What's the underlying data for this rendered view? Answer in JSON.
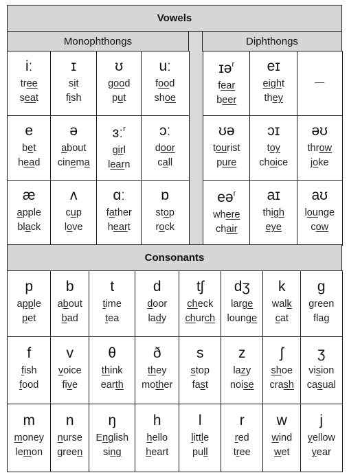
{
  "vowels": {
    "title": "Vowels",
    "monophthongs": {
      "title": "Monophthongs",
      "rows": [
        [
          {
            "symbol": "iː",
            "words": [
              [
                "tr",
                "ee"
              ],
              [
                "s",
                "ea",
                "t"
              ]
            ]
          },
          {
            "symbol": "ɪ",
            "words": [
              [
                "s",
                "i",
                "t"
              ],
              [
                "f",
                "i",
                "sh"
              ]
            ]
          },
          {
            "symbol": "ʊ",
            "words": [
              [
                "g",
                "oo",
                "d"
              ],
              [
                "p",
                "u",
                "t"
              ]
            ]
          },
          {
            "symbol": "uː",
            "words": [
              [
                "f",
                "oo",
                "d"
              ],
              [
                "sh",
                "oe"
              ]
            ]
          }
        ],
        [
          {
            "symbol": "e",
            "words": [
              [
                "b",
                "e",
                "t"
              ],
              [
                "h",
                "ea",
                "d"
              ]
            ]
          },
          {
            "symbol": "ə",
            "words": [
              [
                "",
                "a",
                "bout"
              ],
              [
                "cin",
                "e",
                "m",
                "a"
              ]
            ]
          },
          {
            "symbol": "ɜː",
            "sup": "r",
            "words": [
              [
                "g",
                "ir",
                "l"
              ],
              [
                "l",
                "ear",
                "n"
              ]
            ]
          },
          {
            "symbol": "ɔː",
            "words": [
              [
                "d",
                "oor"
              ],
              [
                "c",
                "a",
                "ll"
              ]
            ]
          }
        ],
        [
          {
            "symbol": "æ",
            "words": [
              [
                "",
                "a",
                "pple"
              ],
              [
                "bl",
                "a",
                "ck"
              ]
            ]
          },
          {
            "symbol": "ʌ",
            "words": [
              [
                "c",
                "u",
                "p"
              ],
              [
                "l",
                "o",
                "ve"
              ]
            ]
          },
          {
            "symbol": "ɑː",
            "words": [
              [
                "f",
                "a",
                "ther"
              ],
              [
                "h",
                "ear",
                "t"
              ]
            ]
          },
          {
            "symbol": "ɒ",
            "words": [
              [
                "st",
                "o",
                "p"
              ],
              [
                "r",
                "o",
                "ck"
              ]
            ]
          }
        ]
      ]
    },
    "diphthongs": {
      "title": "Diphthongs",
      "rows": [
        [
          {
            "symbol": "ɪə",
            "sup": "r",
            "words": [
              [
                "f",
                "ear"
              ],
              [
                "b",
                "eer"
              ]
            ]
          },
          {
            "symbol": "eɪ",
            "words": [
              [
                "",
                "eigh",
                "t"
              ],
              [
                "th",
                "ey"
              ]
            ]
          },
          {
            "symbol": "",
            "dash": "—",
            "words": []
          }
        ],
        [
          {
            "symbol": "ʊə",
            "words": [
              [
                "t",
                "ou",
                "rist"
              ],
              [
                "p",
                "ure"
              ]
            ]
          },
          {
            "symbol": "ɔɪ",
            "words": [
              [
                "t",
                "oy"
              ],
              [
                "ch",
                "oi",
                "ce"
              ]
            ]
          },
          {
            "symbol": "əʊ",
            "words": [
              [
                "thr",
                "ow"
              ],
              [
                "j",
                "o",
                "ke"
              ]
            ]
          }
        ],
        [
          {
            "symbol": "eə",
            "sup": "r",
            "words": [
              [
                "wh",
                "ere"
              ],
              [
                "ch",
                "air"
              ]
            ]
          },
          {
            "symbol": "aɪ",
            "words": [
              [
                "th",
                "igh"
              ],
              [
                "",
                "eye"
              ]
            ]
          },
          {
            "symbol": "aʊ",
            "words": [
              [
                "l",
                "ou",
                "nge"
              ],
              [
                "c",
                "ow"
              ]
            ]
          }
        ]
      ]
    }
  },
  "consonants": {
    "title": "Consonants",
    "rows": [
      [
        {
          "symbol": "p",
          "words": [
            [
              "a",
              "pp",
              "le"
            ],
            [
              "",
              "p",
              "et"
            ]
          ]
        },
        {
          "symbol": "b",
          "words": [
            [
              "a",
              "b",
              "out"
            ],
            [
              "",
              "b",
              "ad"
            ]
          ]
        },
        {
          "symbol": "t",
          "words": [
            [
              "",
              "t",
              "ime"
            ],
            [
              "",
              "t",
              "ea"
            ]
          ]
        },
        {
          "symbol": "d",
          "words": [
            [
              "",
              "d",
              "oor"
            ],
            [
              "la",
              "d",
              "y"
            ]
          ]
        },
        {
          "symbol": "tʃ",
          "words": [
            [
              "",
              "ch",
              "eck"
            ],
            [
              "",
              "ch",
              "ur",
              "ch"
            ]
          ]
        },
        {
          "symbol": "dʒ",
          "words": [
            [
              "lar",
              "ge"
            ],
            [
              "loun",
              "ge"
            ]
          ]
        },
        {
          "symbol": "k",
          "words": [
            [
              "wal",
              "k"
            ],
            [
              "",
              "c",
              "at"
            ]
          ]
        },
        {
          "symbol": "g",
          "words": [
            [
              "green"
            ],
            [
              "flag"
            ]
          ]
        }
      ],
      [
        {
          "symbol": "f",
          "words": [
            [
              "",
              "f",
              "ish"
            ],
            [
              "",
              "f",
              "ood"
            ]
          ]
        },
        {
          "symbol": "v",
          "words": [
            [
              "",
              "v",
              "oice"
            ],
            [
              "fi",
              "v",
              "e"
            ]
          ]
        },
        {
          "symbol": "θ",
          "words": [
            [
              "",
              "th",
              "ink"
            ],
            [
              "ear",
              "th"
            ]
          ]
        },
        {
          "symbol": "ð",
          "words": [
            [
              "",
              "th",
              "ey"
            ],
            [
              "mo",
              "th",
              "er"
            ]
          ]
        },
        {
          "symbol": "s",
          "words": [
            [
              "",
              "s",
              "top"
            ],
            [
              "fa",
              "s",
              "t"
            ]
          ]
        },
        {
          "symbol": "z",
          "words": [
            [
              "la",
              "z",
              "y"
            ],
            [
              "noi",
              "se"
            ]
          ]
        },
        {
          "symbol": "ʃ",
          "words": [
            [
              "",
              "sh",
              "oe"
            ],
            [
              "cra",
              "sh"
            ]
          ]
        },
        {
          "symbol": "ʒ",
          "words": [
            [
              "vi",
              "s",
              "ion"
            ],
            [
              "ca",
              "s",
              "ual"
            ]
          ]
        }
      ],
      [
        {
          "symbol": "m",
          "words": [
            [
              "",
              "m",
              "oney"
            ],
            [
              "le",
              "m",
              "on"
            ]
          ]
        },
        {
          "symbol": "n",
          "words": [
            [
              "",
              "n",
              "urse"
            ],
            [
              "gree",
              "n"
            ]
          ]
        },
        {
          "symbol": "ŋ",
          "words": [
            [
              "E",
              "ng",
              "lish"
            ],
            [
              "si",
              "ng"
            ]
          ]
        },
        {
          "symbol": "h",
          "words": [
            [
              "",
              "h",
              "ello"
            ],
            [
              "",
              "h",
              "eart"
            ]
          ]
        },
        {
          "symbol": "l",
          "words": [
            [
              "",
              "l",
              "itt",
              "l",
              "e"
            ],
            [
              "pu",
              "ll"
            ]
          ]
        },
        {
          "symbol": "r",
          "words": [
            [
              "",
              "r",
              "ed"
            ],
            [
              "t",
              "r",
              "ee"
            ]
          ]
        },
        {
          "symbol": "w",
          "words": [
            [
              "",
              "w",
              "ind"
            ],
            [
              "",
              "w",
              "et"
            ]
          ]
        },
        {
          "symbol": "j",
          "words": [
            [
              "",
              "y",
              "ellow"
            ],
            [
              "",
              "y",
              "ear"
            ]
          ]
        }
      ]
    ]
  }
}
